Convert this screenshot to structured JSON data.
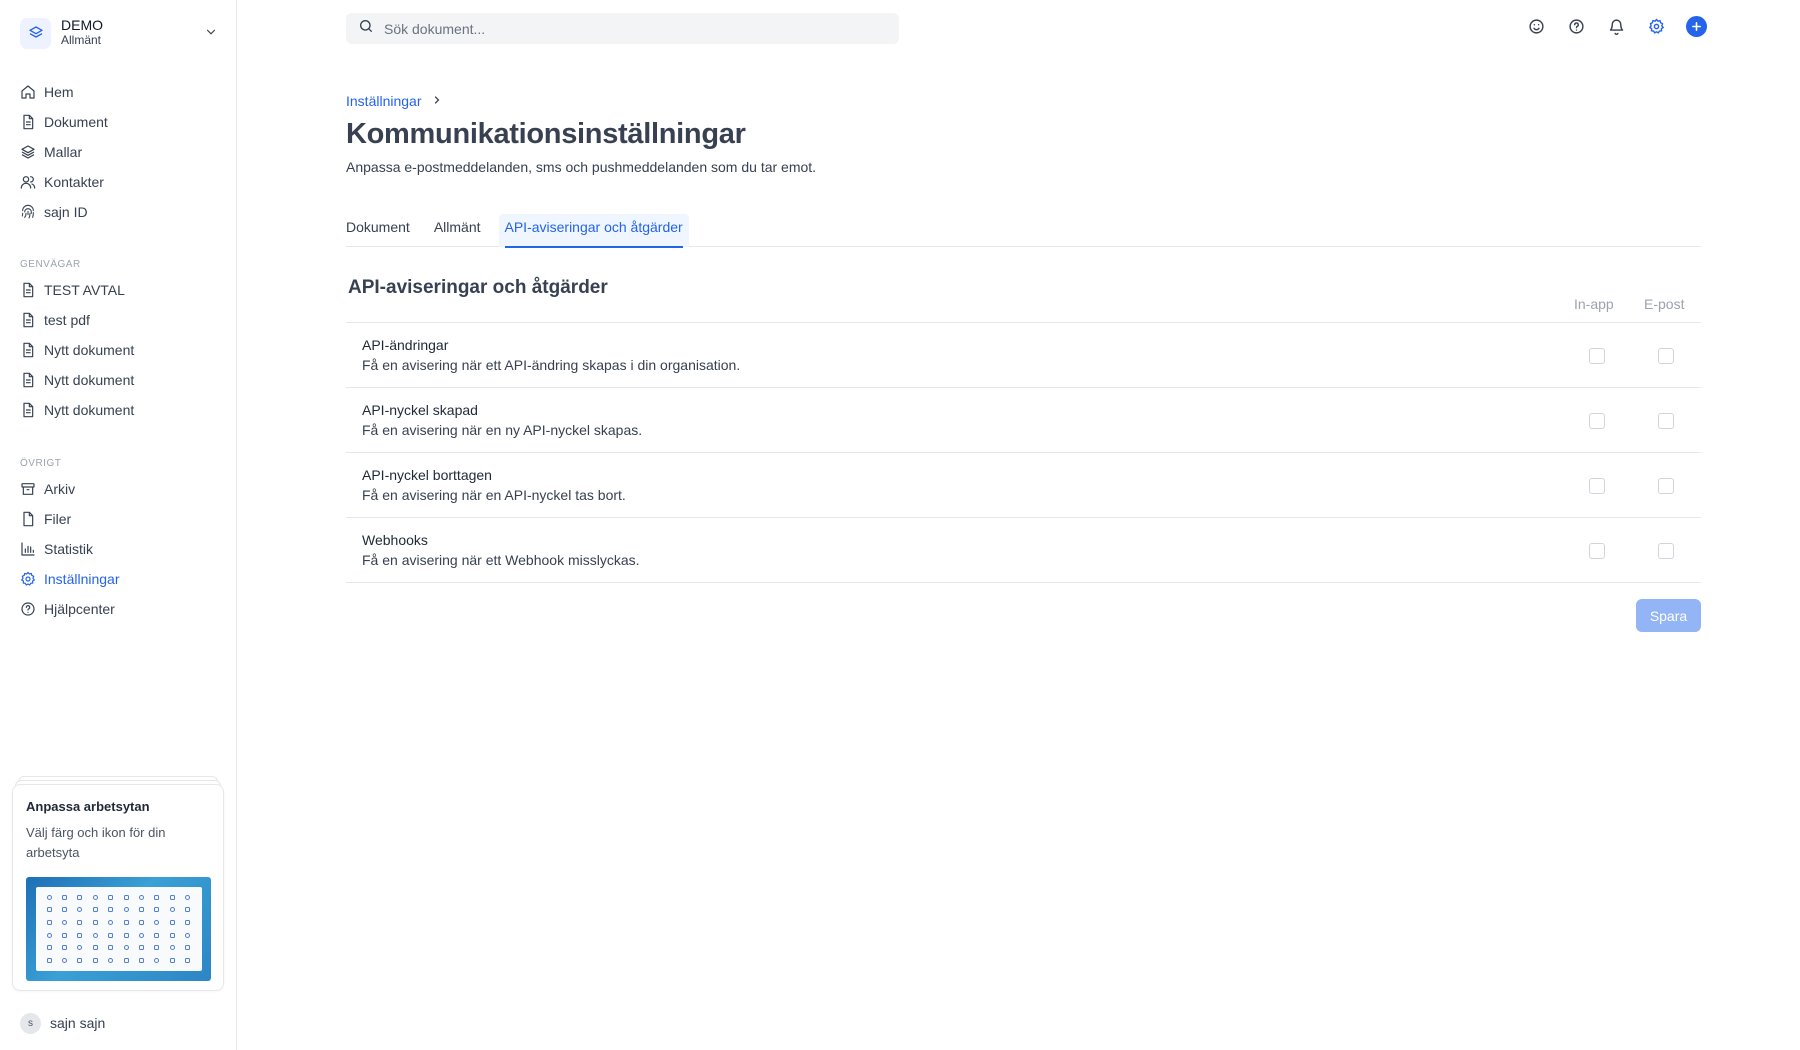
{
  "workspace": {
    "name": "DEMO",
    "subtitle": "Allmänt"
  },
  "nav": {
    "main": [
      {
        "label": "Hem",
        "icon": "home-icon"
      },
      {
        "label": "Dokument",
        "icon": "document-icon"
      },
      {
        "label": "Mallar",
        "icon": "layers-icon"
      },
      {
        "label": "Kontakter",
        "icon": "users-icon"
      },
      {
        "label": "sajn ID",
        "icon": "fingerprint-icon"
      }
    ],
    "shortcuts_title": "GENVÄGAR",
    "shortcuts": [
      {
        "label": "TEST AVTAL",
        "icon": "document-icon"
      },
      {
        "label": "test pdf",
        "icon": "document-icon"
      },
      {
        "label": "Nytt dokument",
        "icon": "document-icon"
      },
      {
        "label": "Nytt dokument",
        "icon": "document-icon"
      },
      {
        "label": "Nytt dokument",
        "icon": "document-icon"
      }
    ],
    "other_title": "ÖVRIGT",
    "other": [
      {
        "label": "Arkiv",
        "icon": "archive-icon"
      },
      {
        "label": "Filer",
        "icon": "file-icon"
      },
      {
        "label": "Statistik",
        "icon": "bar-chart-icon"
      },
      {
        "label": "Inställningar",
        "icon": "gear-icon",
        "active": true
      },
      {
        "label": "Hjälpcenter",
        "icon": "help-circle-icon"
      }
    ]
  },
  "promo": {
    "title": "Anpassa arbetsytan",
    "text": "Välj färg och ikon för din arbetsyta"
  },
  "user": {
    "initial": "s",
    "name": "sajn sajn"
  },
  "search": {
    "placeholder": "Sök dokument..."
  },
  "top_icons": [
    "smiley-icon",
    "help-circle-icon",
    "bell-icon",
    "gear-icon",
    "plus-icon"
  ],
  "breadcrumb": {
    "parent": "Inställningar"
  },
  "page": {
    "title": "Kommunikationsinställningar",
    "subtitle": "Anpassa e-postmeddelanden, sms och pushmeddelanden som du tar emot."
  },
  "tabs": [
    {
      "label": "Dokument",
      "active": false
    },
    {
      "label": "Allmänt",
      "active": false
    },
    {
      "label": "API-aviseringar och åtgärder",
      "active": true
    }
  ],
  "section": {
    "title": "API-aviseringar och åtgärder",
    "col_inapp": "In-app",
    "col_email": "E-post"
  },
  "rows": [
    {
      "title": "API-ändringar",
      "desc": "Få en avisering när ett API-ändring skapas i din organisation.",
      "inapp": false,
      "email": false
    },
    {
      "title": "API-nyckel skapad",
      "desc": "Få en avisering när en ny API-nyckel skapas.",
      "inapp": false,
      "email": false
    },
    {
      "title": "API-nyckel borttagen",
      "desc": "Få en avisering när en API-nyckel tas bort.",
      "inapp": false,
      "email": false
    },
    {
      "title": "Webhooks",
      "desc": "Få en avisering när ett Webhook misslyckas.",
      "inapp": false,
      "email": false
    }
  ],
  "save_label": "Spara",
  "colors": {
    "accent": "#2563eb",
    "save_disabled": "#93b4f5",
    "border": "#e5e7eb"
  }
}
